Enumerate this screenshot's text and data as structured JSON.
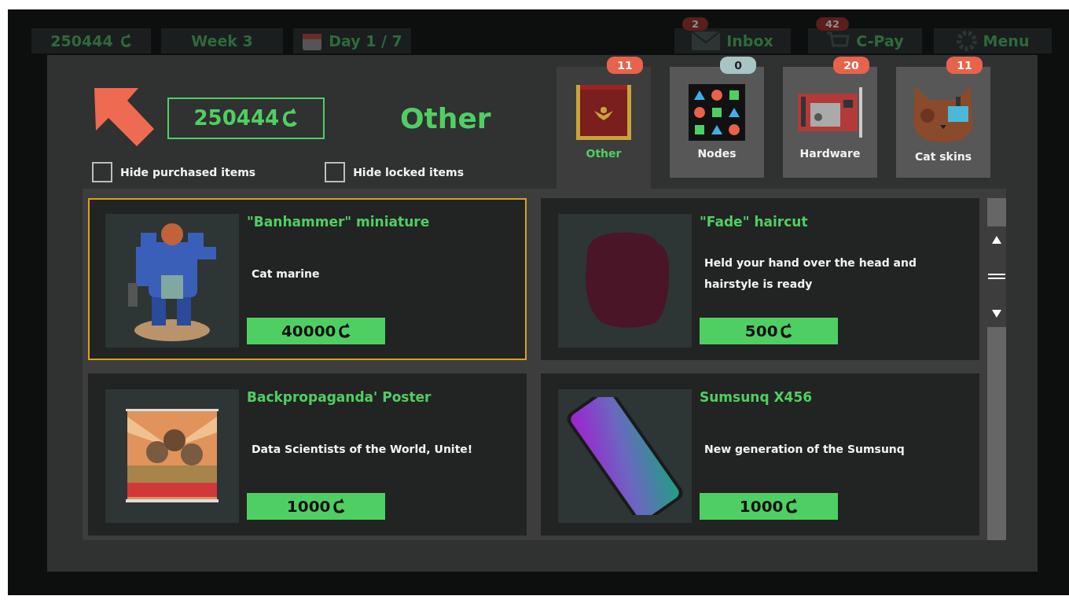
{
  "hud": {
    "money": "250444",
    "week": "Week 3",
    "day": "Day 1 / 7",
    "inbox": {
      "label": "Inbox",
      "badge": "2"
    },
    "shop": {
      "label": "C-Pay",
      "badge": "42"
    },
    "menu": "Menu"
  },
  "shop": {
    "balance": "250444",
    "title": "Other",
    "filters": [
      {
        "label": "Hide purchased items",
        "checked": false
      },
      {
        "label": "Hide locked items",
        "checked": false
      }
    ],
    "tabs": [
      {
        "label": "Other",
        "badge": "11",
        "color": "#e8624c",
        "kind": "chest",
        "selected": true
      },
      {
        "label": "Nodes",
        "badge": "0",
        "color": "#a9c4c4",
        "kind": "nodes",
        "selected": false
      },
      {
        "label": "Hardware",
        "badge": "20",
        "color": "#e8624c",
        "kind": "card",
        "selected": false
      },
      {
        "label": "Cat skins",
        "badge": "11",
        "color": "#e8624c",
        "kind": "cat",
        "selected": false
      }
    ],
    "items": [
      {
        "name": "\"Banhammer\" miniature",
        "description": "Cat marine",
        "price": "40000",
        "kind": "figure",
        "selected": true
      },
      {
        "name": "\"Fade\" haircut",
        "description": "Held your hand over the head and hairstyle is ready",
        "price": "500",
        "kind": "hair",
        "selected": false
      },
      {
        "name": "Backpropaganda' Poster",
        "description": "Data Scientists of the World, Unite!",
        "price": "1000",
        "kind": "poster",
        "selected": false
      },
      {
        "name": "Sumsunq X456",
        "description": "New generation of the Sumsunq",
        "price": "1000",
        "kind": "phone",
        "selected": false
      }
    ]
  }
}
